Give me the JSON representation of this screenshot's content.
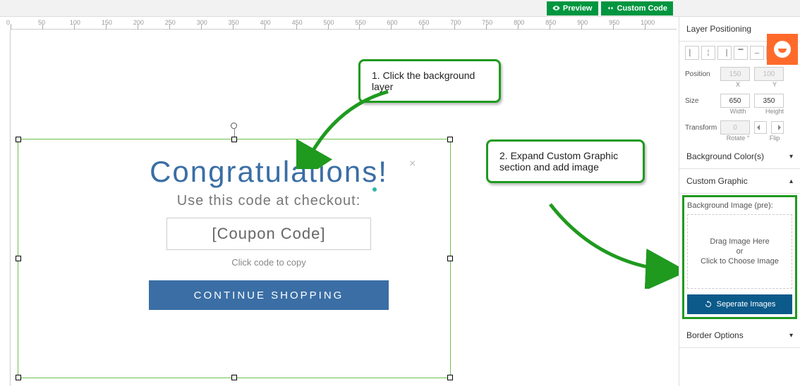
{
  "topbar": {
    "preview_label": "Preview",
    "custom_code_label": "Custom Code"
  },
  "ruler": {
    "ticks": [
      "0",
      "50",
      "100",
      "150",
      "200",
      "250",
      "300",
      "350",
      "400",
      "450",
      "500",
      "550",
      "600",
      "650",
      "700",
      "750",
      "800",
      "850",
      "900",
      "950",
      "1000"
    ]
  },
  "popup": {
    "title": "Congratulations!",
    "subtitle": "Use this code at checkout:",
    "coupon_placeholder": "[Coupon Code]",
    "copy_hint": "Click code to copy",
    "continue_label": "CONTINUE SHOPPING",
    "close_glyph": "×"
  },
  "callouts": {
    "c1": "1. Click the background layer",
    "c2": "2. Expand Custom Graphic section and add image"
  },
  "sidebar": {
    "layer_positioning": "Layer Positioning",
    "position_label": "Position",
    "position_x": "150",
    "position_y": "100",
    "pos_x_label": "X",
    "pos_y_label": "Y",
    "size_label": "Size",
    "size_w": "650",
    "size_h": "350",
    "size_w_label": "Width",
    "size_h_label": "Height",
    "transform_label": "Transform",
    "transform_rotate": "0",
    "rotate_label": "Rotate °",
    "flip_label": "Flip",
    "bg_colors": "Background Color(s)",
    "custom_graphic": "Custom Graphic",
    "bg_image_pre": "Background Image (pre):",
    "drop_line1": "Drag Image Here",
    "drop_line2": "or",
    "drop_line3": "Click to Choose Image",
    "separate_images": "Seperate Images",
    "border_options": "Border Options"
  }
}
